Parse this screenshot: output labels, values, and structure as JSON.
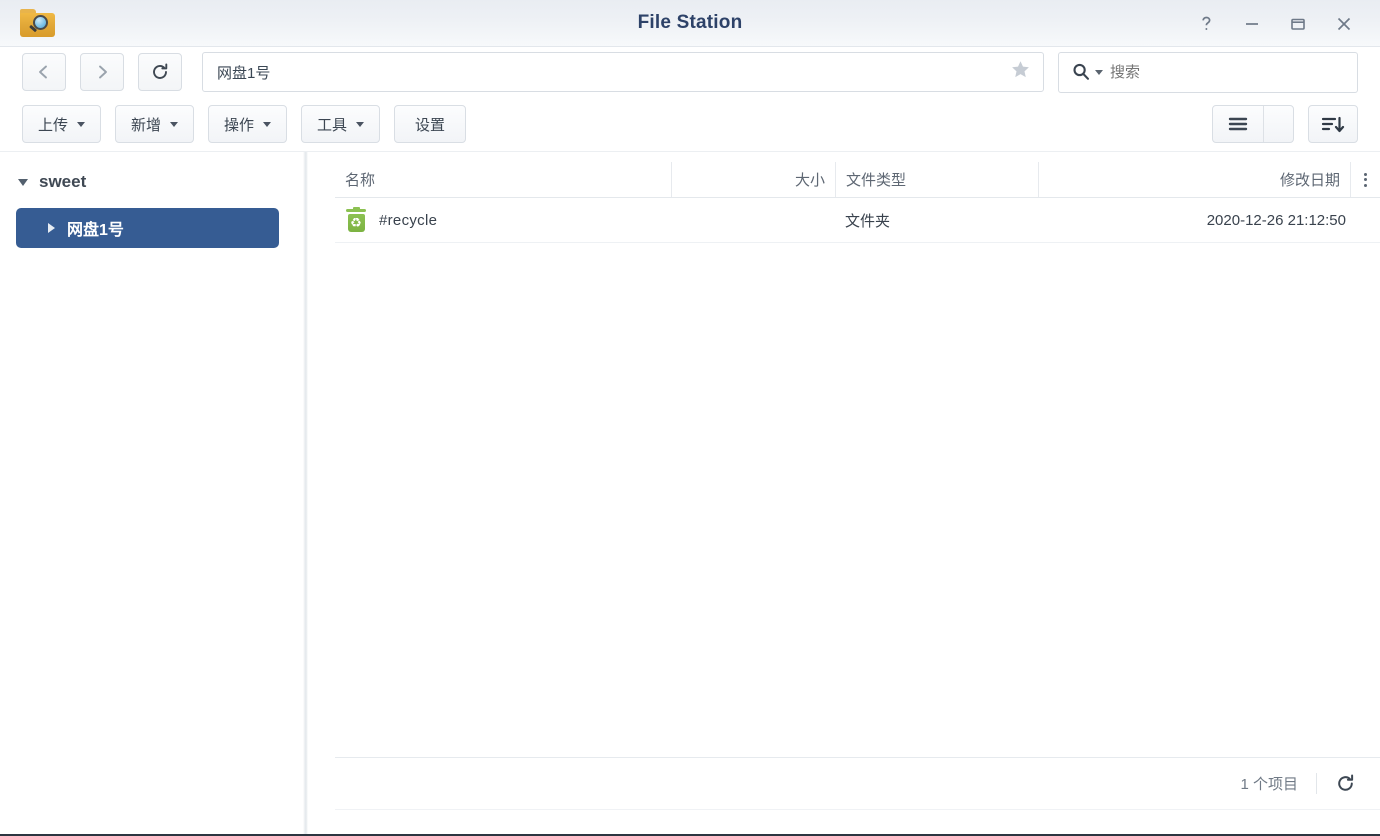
{
  "window": {
    "title": "File Station",
    "app_icon": "folder-search-icon",
    "controls": {
      "help": "help-icon",
      "minimize": "minimize-icon",
      "maximize": "maximize-icon",
      "close": "close-icon"
    }
  },
  "nav": {
    "back": "back-arrow-icon",
    "forward": "forward-arrow-icon",
    "refresh": "refresh-icon",
    "address_value": "网盘1号",
    "bookmark": "star-icon"
  },
  "search": {
    "placeholder": "搜索",
    "icon": "search-icon"
  },
  "toolbar": {
    "buttons": [
      {
        "label": "上传",
        "has_dropdown": true
      },
      {
        "label": "新增",
        "has_dropdown": true
      },
      {
        "label": "操作",
        "has_dropdown": true
      },
      {
        "label": "工具",
        "has_dropdown": true
      },
      {
        "label": "设置",
        "has_dropdown": false
      }
    ],
    "view_mode_icon": "list-view-icon",
    "view_mode_caret": "chevron-down-icon",
    "sort_icon": "sort-descending-icon"
  },
  "sidebar": {
    "root": {
      "label": "sweet",
      "expanded": true
    },
    "items": [
      {
        "label": "网盘1号",
        "selected": true,
        "expanded": false
      }
    ]
  },
  "table": {
    "columns": [
      {
        "key": "name",
        "label": "名称"
      },
      {
        "key": "size",
        "label": "大小"
      },
      {
        "key": "type",
        "label": "文件类型"
      },
      {
        "key": "date",
        "label": "修改日期"
      }
    ],
    "column_menu_icon": "more-options-icon",
    "rows": [
      {
        "icon": "recycle-bin-icon",
        "name": "#recycle",
        "size": "",
        "type": "文件夹",
        "date": "2020-12-26 21:12:50"
      }
    ]
  },
  "status": {
    "count_label": "1 个项目",
    "refresh_icon": "refresh-icon"
  },
  "colors": {
    "title_text": "#2d4268",
    "selection_blue": "#365c93",
    "recycle_green": "#8cc152",
    "folder_gold": "#e0a636"
  }
}
